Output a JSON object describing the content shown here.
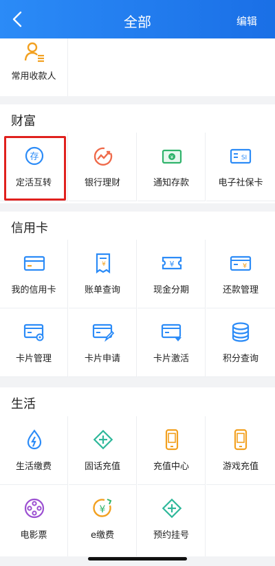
{
  "header": {
    "title": "全部",
    "edit": "编辑"
  },
  "top": {
    "payee": "常用收款人"
  },
  "wealth": {
    "title": "财富",
    "items": [
      "定活互转",
      "银行理财",
      "通知存款",
      "电子社保卡"
    ]
  },
  "credit": {
    "title": "信用卡",
    "items": [
      "我的信用卡",
      "账单查询",
      "现金分期",
      "还款管理",
      "卡片管理",
      "卡片申请",
      "卡片激活",
      "积分查询"
    ]
  },
  "life": {
    "title": "生活",
    "items": [
      "生活缴费",
      "固话充值",
      "充值中心",
      "游戏充值",
      "电影票",
      "e缴费",
      "预约挂号"
    ]
  },
  "colors": {
    "header": "#1a6fe6",
    "blue": "#2b8bf7",
    "orange": "#f2a01f",
    "highlight": "#e0201d"
  }
}
